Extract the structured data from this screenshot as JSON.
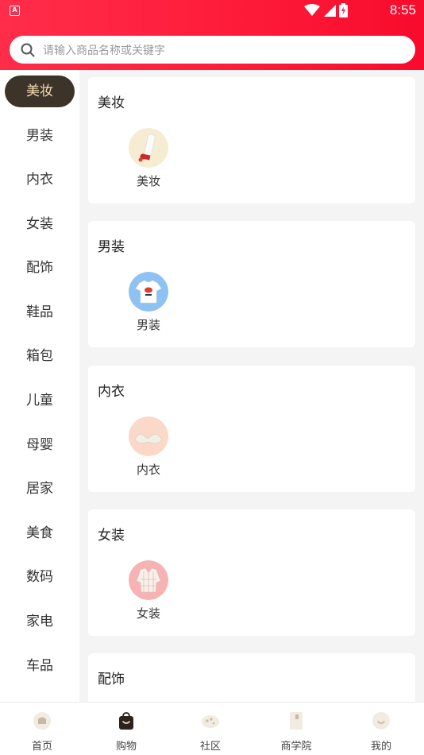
{
  "status_bar": {
    "time": "8:55",
    "app_indicator": "A"
  },
  "search": {
    "placeholder": "请输入商品名称或关键字",
    "icon": "search-icon"
  },
  "sidebar": {
    "items": [
      {
        "label": "美妆",
        "active": true
      },
      {
        "label": "男装"
      },
      {
        "label": "内衣"
      },
      {
        "label": "女装"
      },
      {
        "label": "配饰"
      },
      {
        "label": "鞋品"
      },
      {
        "label": "箱包"
      },
      {
        "label": "儿童"
      },
      {
        "label": "母婴"
      },
      {
        "label": "居家"
      },
      {
        "label": "美食"
      },
      {
        "label": "数码"
      },
      {
        "label": "家电"
      },
      {
        "label": "车品"
      }
    ]
  },
  "sections": [
    {
      "title": "美妆",
      "items": [
        {
          "label": "美妆",
          "icon": "cosmetics-tube-icon"
        }
      ]
    },
    {
      "title": "男装",
      "items": [
        {
          "label": "男装",
          "icon": "tshirt-icon"
        }
      ]
    },
    {
      "title": "内衣",
      "items": [
        {
          "label": "内衣",
          "icon": "bra-icon"
        }
      ]
    },
    {
      "title": "女装",
      "items": [
        {
          "label": "女装",
          "icon": "blouse-icon"
        }
      ]
    },
    {
      "title": "配饰",
      "items": []
    }
  ],
  "tabbar": {
    "tabs": [
      {
        "label": "首页",
        "icon": "home-icon"
      },
      {
        "label": "购物",
        "icon": "shopping-bag-icon",
        "active": true
      },
      {
        "label": "社区",
        "icon": "community-icon"
      },
      {
        "label": "商学院",
        "icon": "book-icon"
      },
      {
        "label": "我的",
        "icon": "profile-icon"
      }
    ]
  },
  "colors": {
    "header": "#ff1f3d",
    "active_pill": "#3c3428",
    "active_text": "#f5dcb6"
  }
}
